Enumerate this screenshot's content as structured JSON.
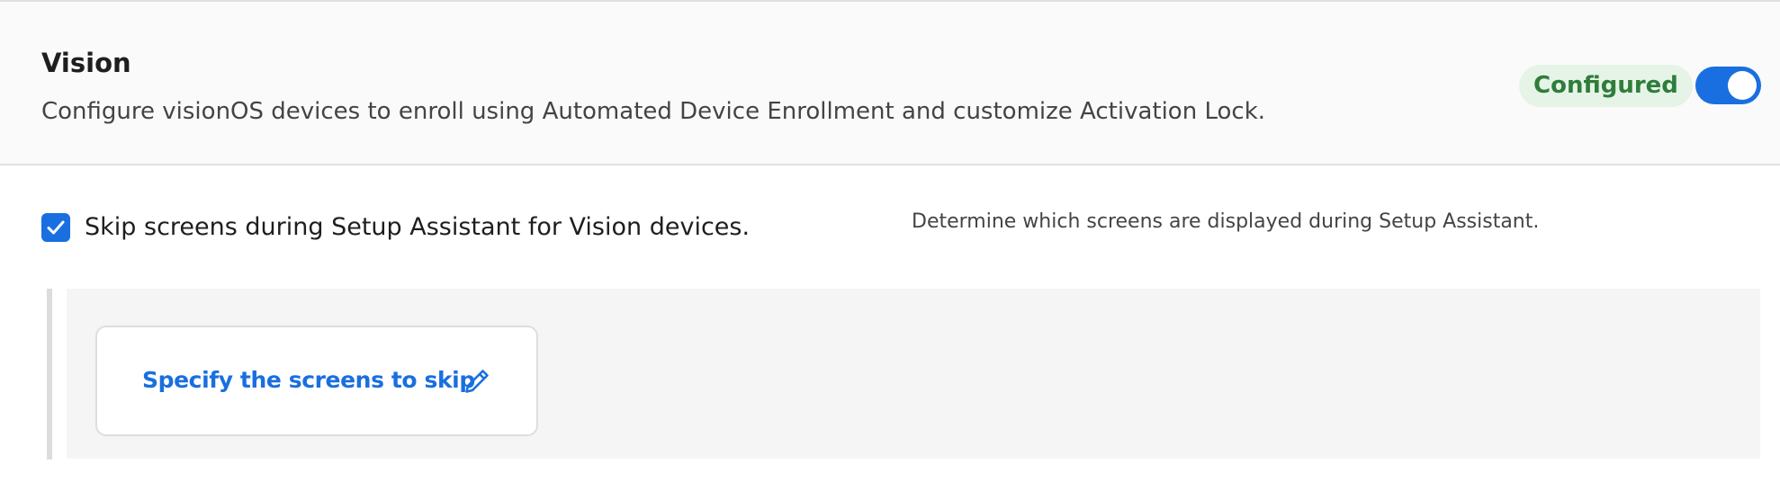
{
  "section": {
    "title": "Vision",
    "description": "Configure visionOS devices to enroll using Automated Device Enrollment and customize Activation Lock.",
    "status": "Configured",
    "enabled": true
  },
  "option": {
    "checked": true,
    "label": "Skip screens during Setup Assistant for Vision devices.",
    "help": "Determine which screens are displayed during Setup Assistant."
  },
  "skip_card": {
    "label": "Specify the screens to skip",
    "icon": "pencil-icon"
  },
  "colors": {
    "accent": "#1a6fe0",
    "status_text": "#2f7d3a",
    "status_bg": "#e6f4e8"
  }
}
